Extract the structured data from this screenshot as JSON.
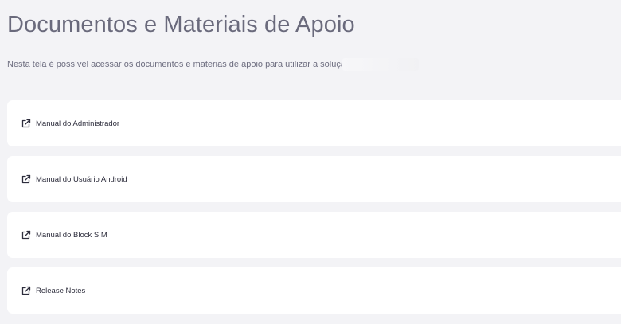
{
  "header": {
    "title": "Documentos e Materiais de Apoio",
    "subtitle": "Nesta tela é possível acessar os documentos e materias de apoio para utilizar a solução"
  },
  "documents": [
    {
      "label": "Manual do Administrador",
      "icon": "external-link-icon"
    },
    {
      "label": "Manual do Usuário Android",
      "icon": "external-link-icon"
    },
    {
      "label": "Manual do Block SIM",
      "icon": "external-link-icon"
    },
    {
      "label": "Release Notes",
      "icon": "external-link-icon"
    }
  ],
  "colors": {
    "background": "#f3f3f6",
    "card": "#ffffff",
    "title": "#6a6a7c",
    "text": "#2d2d3c"
  }
}
